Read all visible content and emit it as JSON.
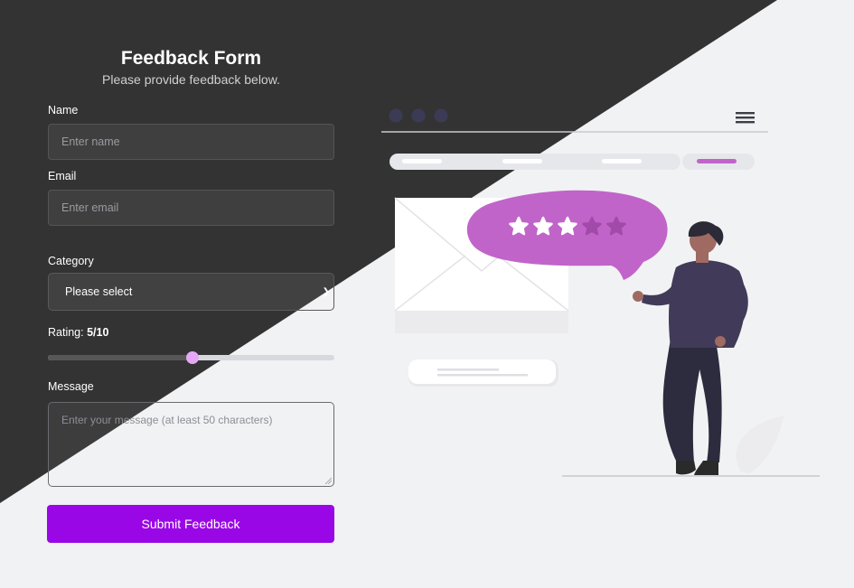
{
  "form": {
    "title": "Feedback Form",
    "subtitle": "Please provide feedback below.",
    "name_label": "Name",
    "name_placeholder": "Enter name",
    "email_label": "Email",
    "email_placeholder": "Enter email",
    "category_label": "Category",
    "category_selected": "Please select",
    "rating_label": "Rating:",
    "rating_value": "5/10",
    "rating_fraction": 0.5,
    "message_label": "Message",
    "message_placeholder": "Enter your message (at least 50 characters)",
    "submit_label": "Submit Feedback"
  },
  "illustration": {
    "stars_filled": 3,
    "stars_total": 5
  },
  "colors": {
    "dark_bg": "#333333",
    "light_bg": "#f1f2f4",
    "accent": "#9a07e6",
    "bubble": "#c164c9",
    "thumb": "#e4a8f5"
  }
}
